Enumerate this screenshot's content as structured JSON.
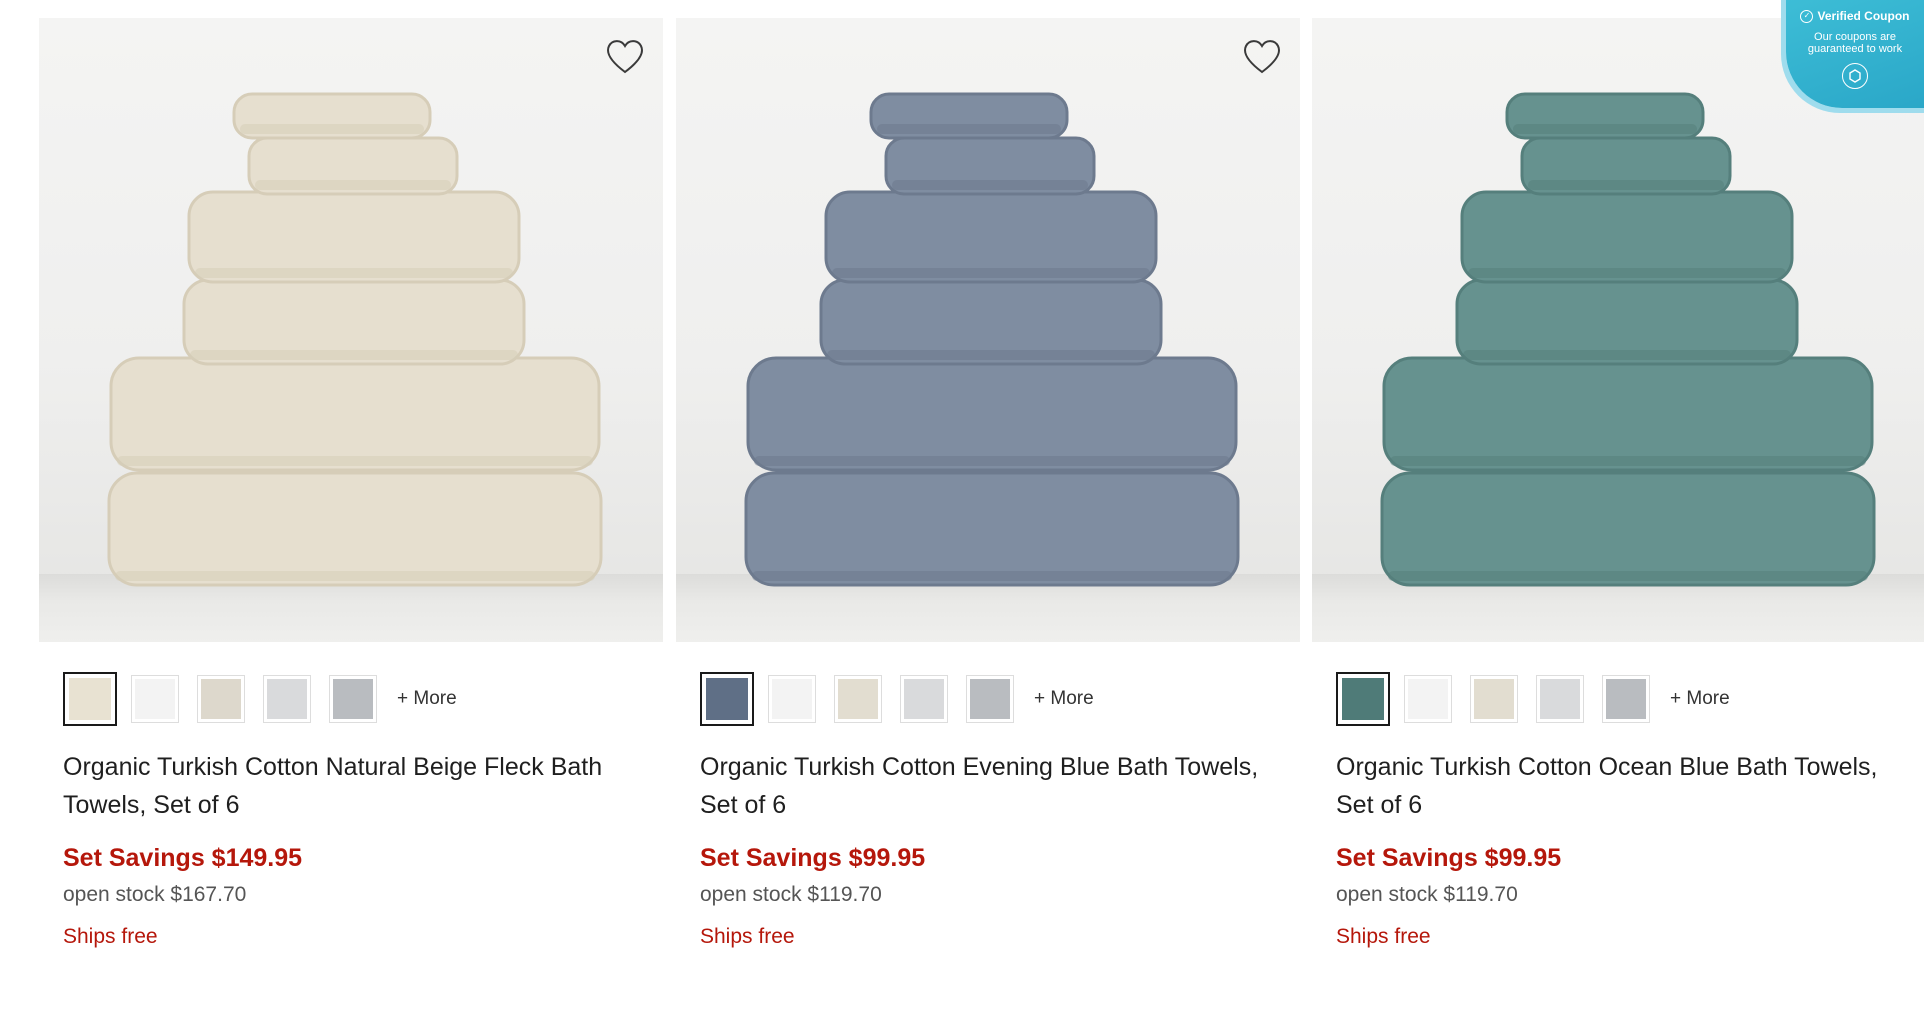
{
  "products": [
    {
      "name": "Organic Turkish Cotton Natural Beige Fleck Bath Towels, Set of 6",
      "set_savings": "Set Savings $149.95",
      "open_stock": "open stock $167.70",
      "shipping": "Ships free",
      "more_label": "+ More",
      "towel_color": "#e6dfcf",
      "towel_shade": "#d6cdb8",
      "swatches": [
        "#e8e2d2",
        "#f3f3f3",
        "#ddd8cc",
        "#d9dadc",
        "#b9bcc0"
      ]
    },
    {
      "name": "Organic Turkish Cotton Evening Blue Bath Towels, Set of 6",
      "set_savings": "Set Savings $99.95",
      "open_stock": "open stock $119.70",
      "shipping": "Ships free",
      "more_label": "+ More",
      "towel_color": "#7f8da1",
      "towel_shade": "#6d7a8e",
      "swatches": [
        "#5f6f86",
        "#f3f3f3",
        "#e2ddd0",
        "#d9dadc",
        "#b9bcc0"
      ]
    },
    {
      "name": "Organic Turkish Cotton Ocean Blue Bath Towels, Set of 6",
      "set_savings": "Set Savings $99.95",
      "open_stock": "open stock $119.70",
      "shipping": "Ships free",
      "more_label": "+ More",
      "towel_color": "#66928f",
      "towel_shade": "#557f7c",
      "swatches": [
        "#4f7b78",
        "#f3f3f3",
        "#e2ddd0",
        "#d9dadc",
        "#b9bcc0"
      ]
    }
  ],
  "coupon_badge": {
    "title": "Verified Coupon",
    "body": "Our coupons are guaranteed to work"
  }
}
